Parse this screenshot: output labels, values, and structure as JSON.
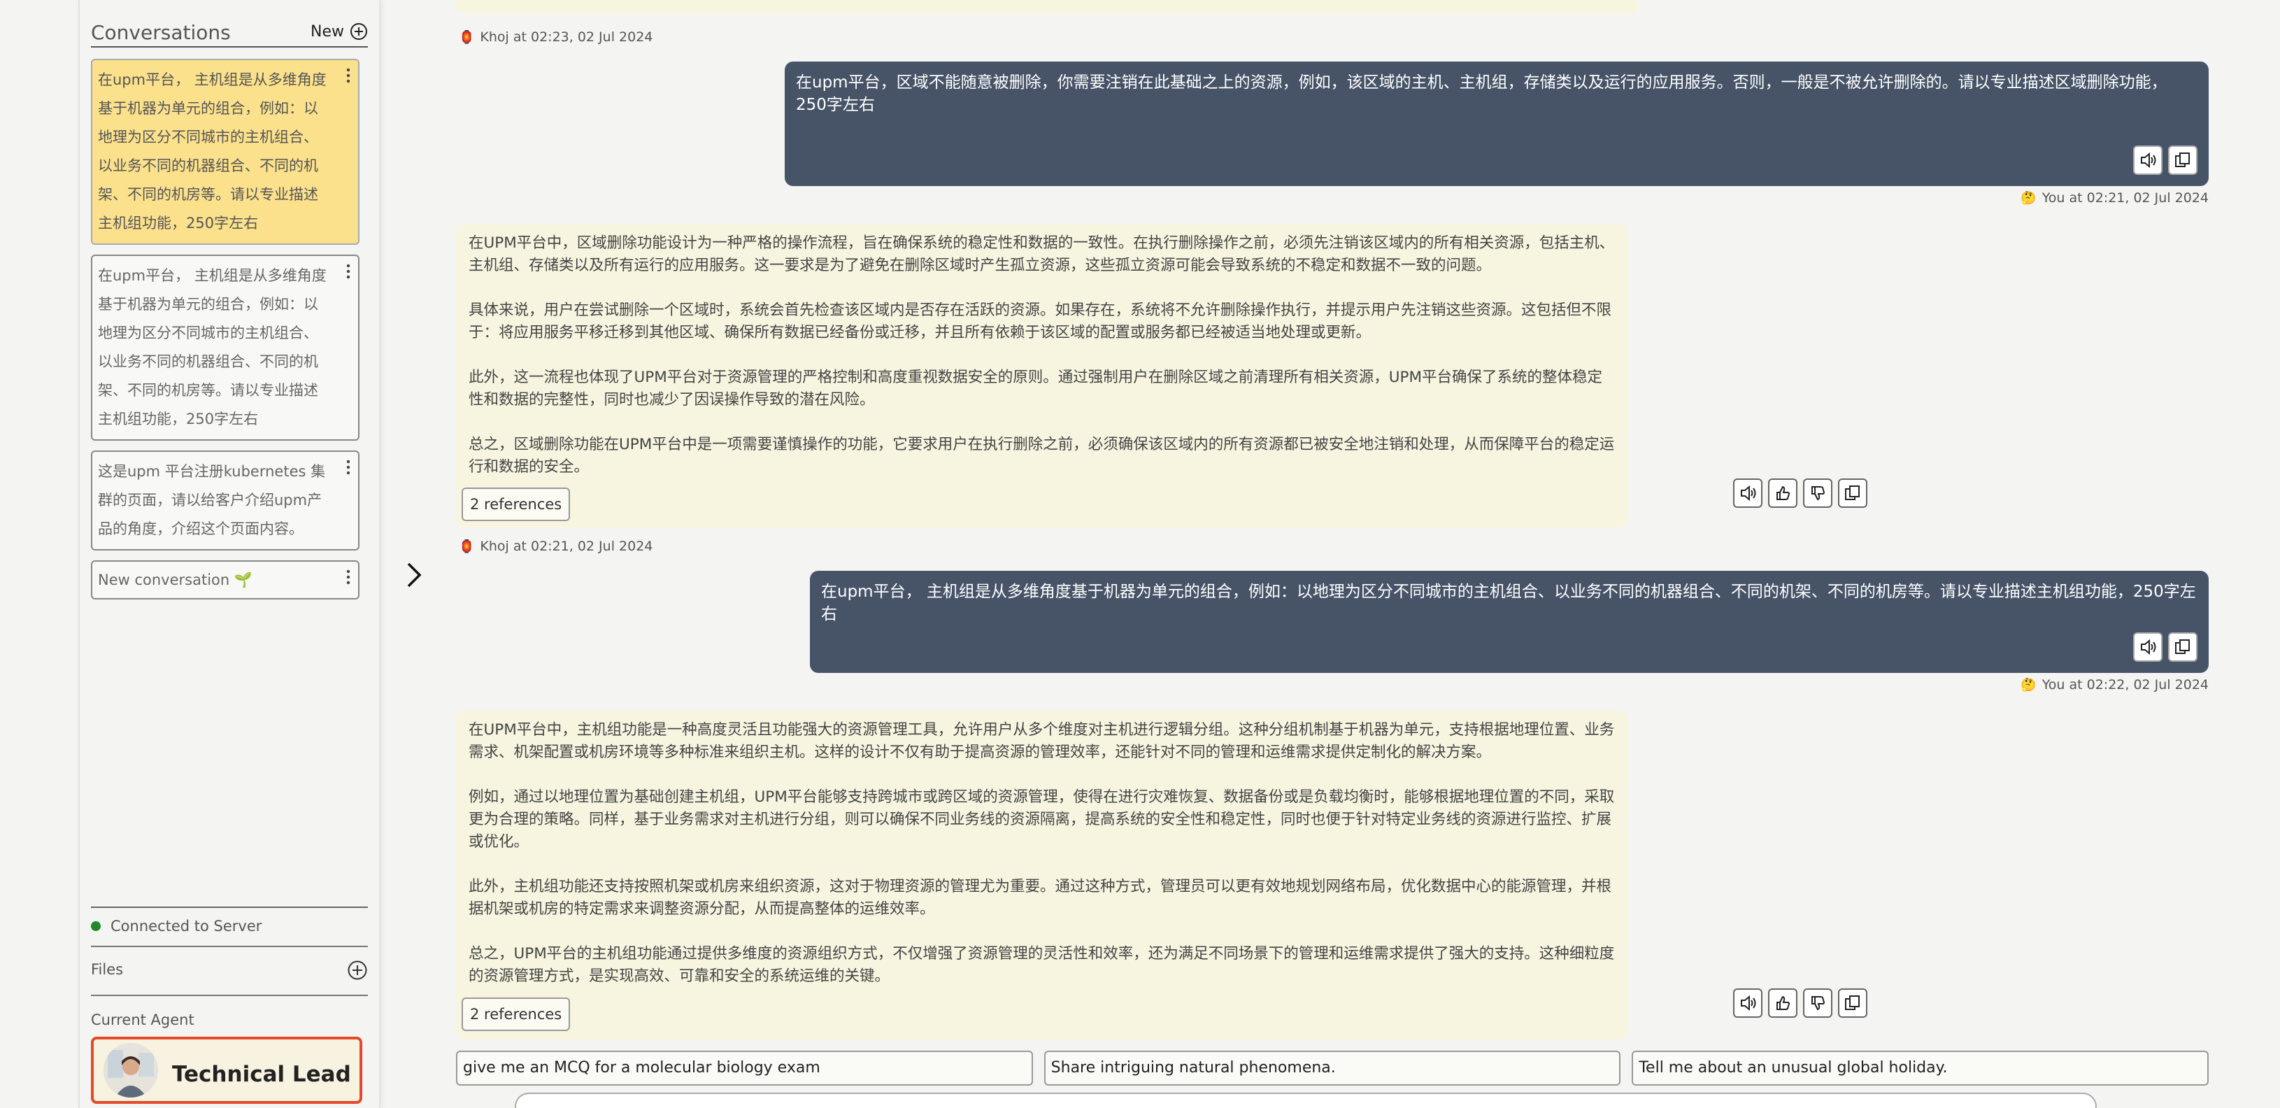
{
  "sidebar": {
    "conversations_title": "Conversations",
    "new_label": "New",
    "conversations": [
      {
        "title": "在upm平台， 主机组是从多维角度基于机器为单元的组合，例如：以地理为区分不同城市的主机组合、以业务不同的机器组合、不同的机架、不同的机房等。请以专业描述主机组功能，250字左右"
      },
      {
        "title": "在upm平台， 主机组是从多维角度基于机器为单元的组合，例如：以地理为区分不同城市的主机组合、以业务不同的机器组合、不同的机架、不同的机房等。请以专业描述主机组功能，250字左右"
      },
      {
        "title": "这是upm 平台注册kubernetes 集群的页面，请以给客户介绍upm产品的角度，介绍这个页面内容。"
      },
      {
        "title": "New conversation 🌱"
      }
    ],
    "connection_status": "Connected to Server",
    "files_label": "Files",
    "current_agent_label": "Current Agent",
    "agent_name": "Technical Lead"
  },
  "chat": {
    "messages": [
      {
        "meta": "Khoj at 02:23, 02 Jul 2024",
        "meta_emoji": "🏮"
      },
      {
        "text": "在upm平台，区域不能随意被删除，你需要注销在此基础之上的资源，例如，该区域的主机、主机组，存储类以及运行的应用服务。否则，一般是不被允许删除的。请以专业描述区域删除功能，250字左右",
        "meta": "You at 02:21, 02 Jul 2024",
        "meta_emoji": "🤔"
      },
      {
        "paragraphs": [
          "在UPM平台中，区域删除功能设计为一种严格的操作流程，旨在确保系统的稳定性和数据的一致性。在执行删除操作之前，必须先注销该区域内的所有相关资源，包括主机、主机组、存储类以及所有运行的应用服务。这一要求是为了避免在删除区域时产生孤立资源，这些孤立资源可能会导致系统的不稳定和数据不一致的问题。",
          "具体来说，用户在尝试删除一个区域时，系统会首先检查该区域内是否存在活跃的资源。如果存在，系统将不允许删除操作执行，并提示用户先注销这些资源。这包括但不限于：将应用服务平移迁移到其他区域、确保所有数据已经备份或迁移，并且所有依赖于该区域的配置或服务都已经被适当地处理或更新。",
          "此外，这一流程也体现了UPM平台对于资源管理的严格控制和高度重视数据安全的原则。通过强制用户在删除区域之前清理所有相关资源，UPM平台确保了系统的整体稳定性和数据的完整性，同时也减少了因误操作导致的潜在风险。",
          "总之，区域删除功能在UPM平台中是一项需要谨慎操作的功能，它要求用户在执行删除之前，必须确保该区域内的所有资源都已被安全地注销和处理，从而保障平台的稳定运行和数据的安全。"
        ],
        "references": "2 references",
        "meta": "Khoj at 02:21, 02 Jul 2024",
        "meta_emoji": "🏮"
      },
      {
        "text": "在upm平台， 主机组是从多维角度基于机器为单元的组合，例如：以地理为区分不同城市的主机组合、以业务不同的机器组合、不同的机架、不同的机房等。请以专业描述主机组功能，250字左右",
        "meta": "You at 02:22, 02 Jul 2024",
        "meta_emoji": "🤔"
      },
      {
        "paragraphs": [
          "在UPM平台中，主机组功能是一种高度灵活且功能强大的资源管理工具，允许用户从多个维度对主机进行逻辑分组。这种分组机制基于机器为单元，支持根据地理位置、业务需求、机架配置或机房环境等多种标准来组织主机。这样的设计不仅有助于提高资源的管理效率，还能针对不同的管理和运维需求提供定制化的解决方案。",
          "例如，通过以地理位置为基础创建主机组，UPM平台能够支持跨城市或跨区域的资源管理，使得在进行灾难恢复、数据备份或是负载均衡时，能够根据地理位置的不同，采取更为合理的策略。同样，基于业务需求对主机进行分组，则可以确保不同业务线的资源隔离，提高系统的安全性和稳定性，同时也便于针对特定业务线的资源进行监控、扩展或优化。",
          "此外，主机组功能还支持按照机架或机房来组织资源，这对于物理资源的管理尤为重要。通过这种方式，管理员可以更有效地规划网络布局，优化数据中心的能源管理，并根据机架或机房的特定需求来调整资源分配，从而提高整体的运维效率。",
          "总之，UPM平台的主机组功能通过提供多维度的资源组织方式，不仅增强了资源管理的灵活性和效率，还为满足不同场景下的管理和运维需求提供了强大的支持。这种细粒度的资源管理方式，是实现高效、可靠和安全的系统运维的关键。"
        ],
        "references": "2 references"
      }
    ],
    "suggestions": [
      "give me an MCQ for a molecular biology exam",
      "Share intriguing natural phenomena.",
      "Tell me about an unusual global holiday."
    ]
  }
}
